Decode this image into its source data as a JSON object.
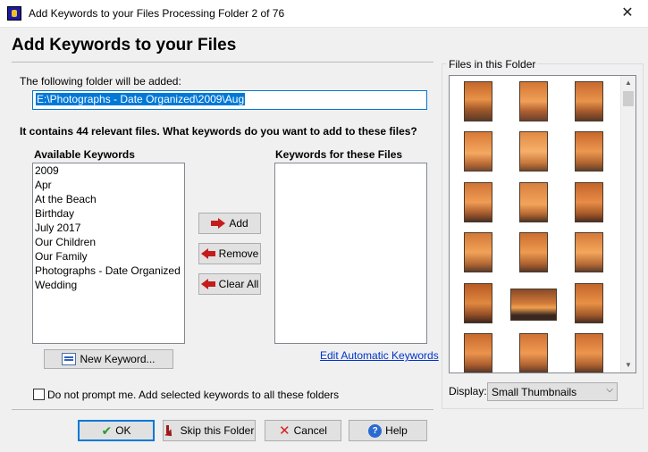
{
  "window": {
    "title": "Add Keywords to your Files Processing Folder 2 of 76",
    "close_glyph": "✕"
  },
  "heading": "Add Keywords to your Files",
  "folder_prompt": "The following folder will be added:",
  "folder_path": "E:\\Photographs - Date Organized\\2009\\Aug",
  "question": "It contains 44 relevant files.  What keywords do you want to add to these files?",
  "available": {
    "title": "Available Keywords",
    "items": [
      "2009",
      "Apr",
      "At the Beach",
      "Birthday",
      "July 2017",
      "Our Children",
      "Our Family",
      "Photographs - Date Organized",
      "Wedding"
    ]
  },
  "selected": {
    "title": "Keywords for these Files",
    "items": []
  },
  "buttons": {
    "add": "Add",
    "remove": "Remove",
    "clear_all": "Clear All",
    "new_keyword": "New Keyword...",
    "ok": "OK",
    "skip": "Skip this Folder",
    "cancel": "Cancel",
    "help": "Help"
  },
  "edit_link": "Edit Automatic Keywords",
  "dont_prompt": "Do not prompt me.  Add selected keywords to all these folders",
  "files_panel": {
    "title": "Files in this Folder",
    "display_label": "Display:",
    "display_value": "Small Thumbnails"
  },
  "colors": {
    "accent": "#0078d7",
    "link": "#0033cc",
    "arrow": "#c41c1c"
  }
}
